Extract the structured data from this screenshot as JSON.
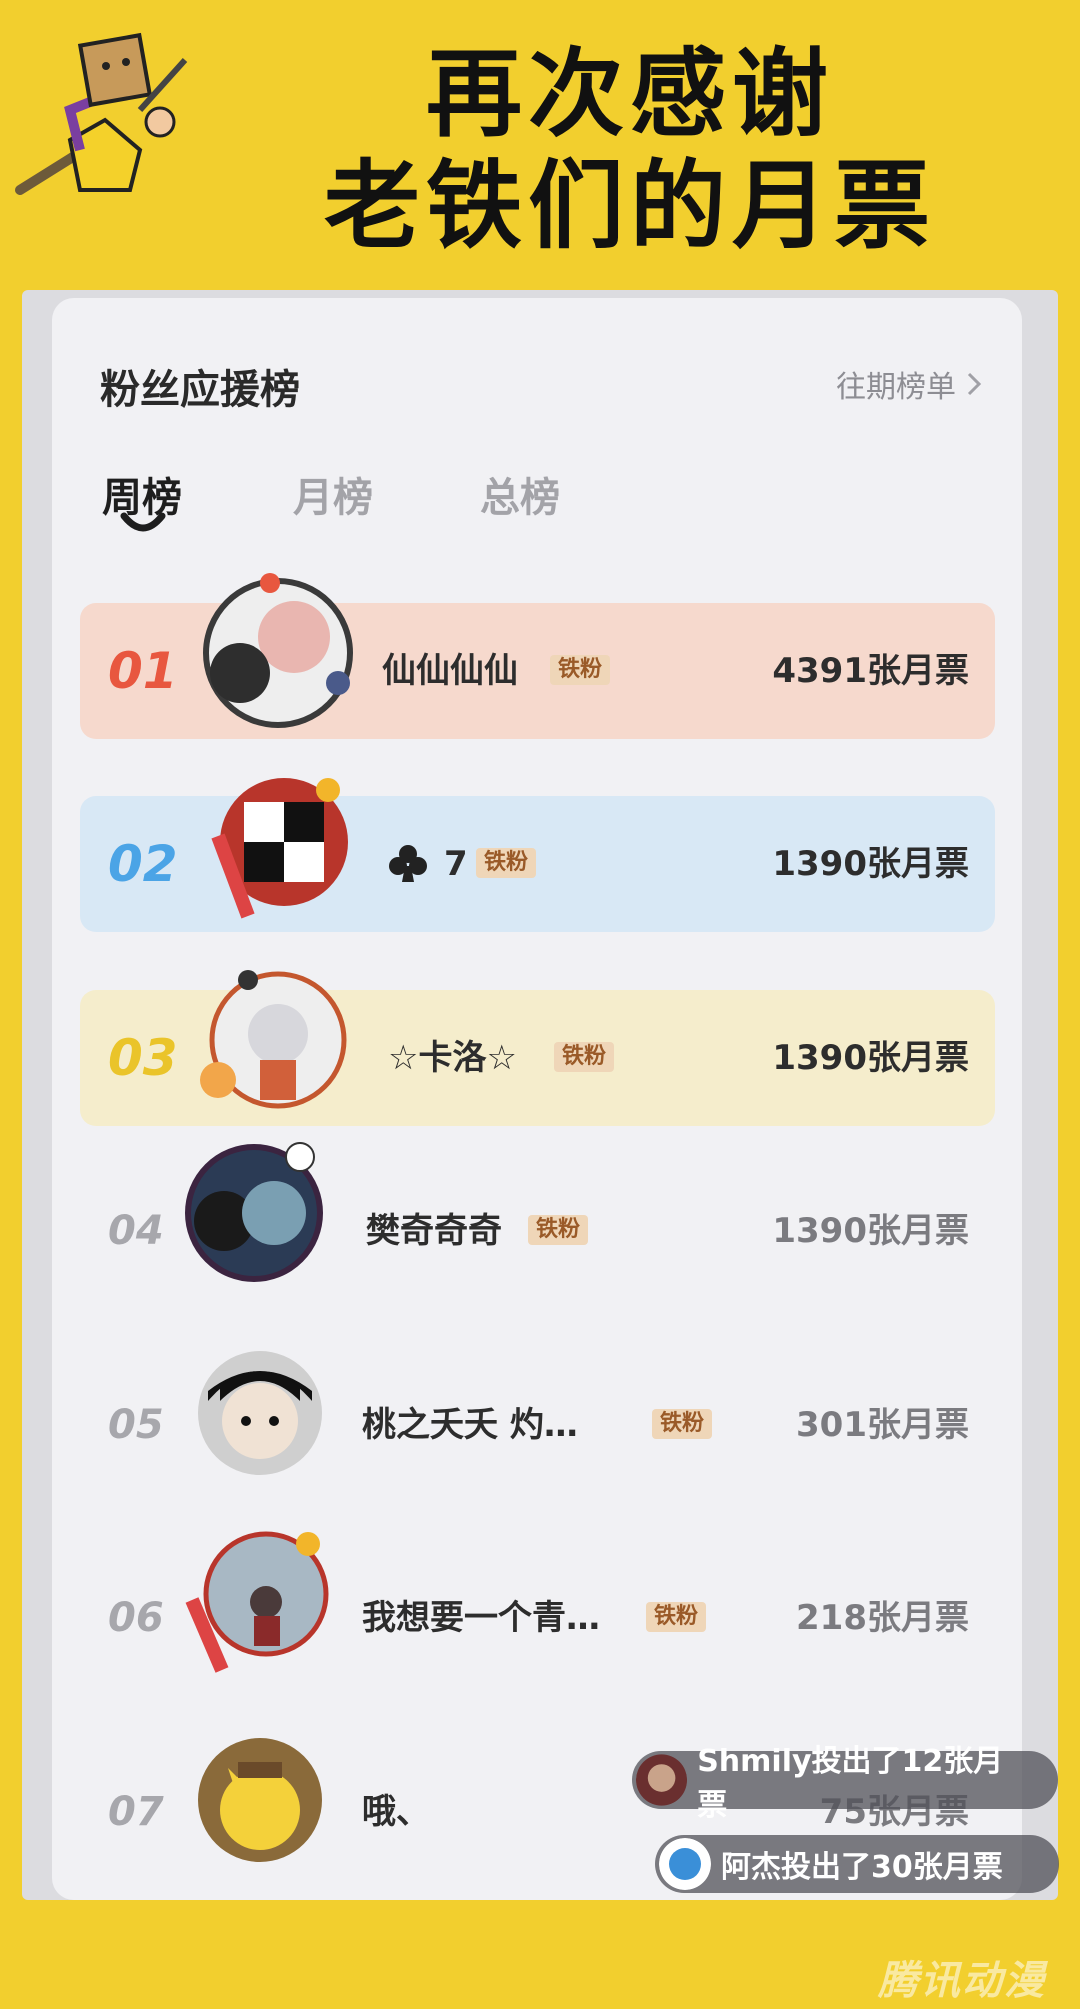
{
  "header": {
    "line1": "再次感谢",
    "line2": "老铁们的月票"
  },
  "card": {
    "title": "粉丝应援榜",
    "history_link": "往期榜单"
  },
  "tabs": [
    {
      "label": "周榜",
      "active": true
    },
    {
      "label": "月榜",
      "active": false
    },
    {
      "label": "总榜",
      "active": false
    }
  ],
  "ranking": [
    {
      "rank": "01",
      "name": "仙仙仙仙",
      "badge": "铁粉",
      "votes": "4391张月票"
    },
    {
      "rank": "02",
      "name": "7",
      "badge": "铁粉",
      "votes": "1390张月票"
    },
    {
      "rank": "03",
      "name": "☆卡洛☆",
      "badge": "铁粉",
      "votes": "1390张月票"
    },
    {
      "rank": "04",
      "name": "樊奇奇奇",
      "badge": "铁粉",
      "votes": "1390张月票"
    },
    {
      "rank": "05",
      "name": "桃之夭夭 灼…",
      "badge": "铁粉",
      "votes": "301张月票"
    },
    {
      "rank": "06",
      "name": "我想要一个青…",
      "badge": "铁粉",
      "votes": "218张月票"
    },
    {
      "rank": "07",
      "name": "哦、",
      "votes": "75张月票"
    }
  ],
  "toasts": [
    "Shmily投出了12张月票",
    "阿杰投出了30张月票"
  ],
  "watermark": "腾讯动漫",
  "colors": {
    "background": "#F2CF2E",
    "rank1_bg": "#F6D9CD",
    "rank1_num": "#E8573F",
    "rank2_bg": "#D8E8F5",
    "rank2_num": "#4BA4E6",
    "rank3_bg": "#F5EDCC",
    "rank3_num": "#EAC42A"
  }
}
